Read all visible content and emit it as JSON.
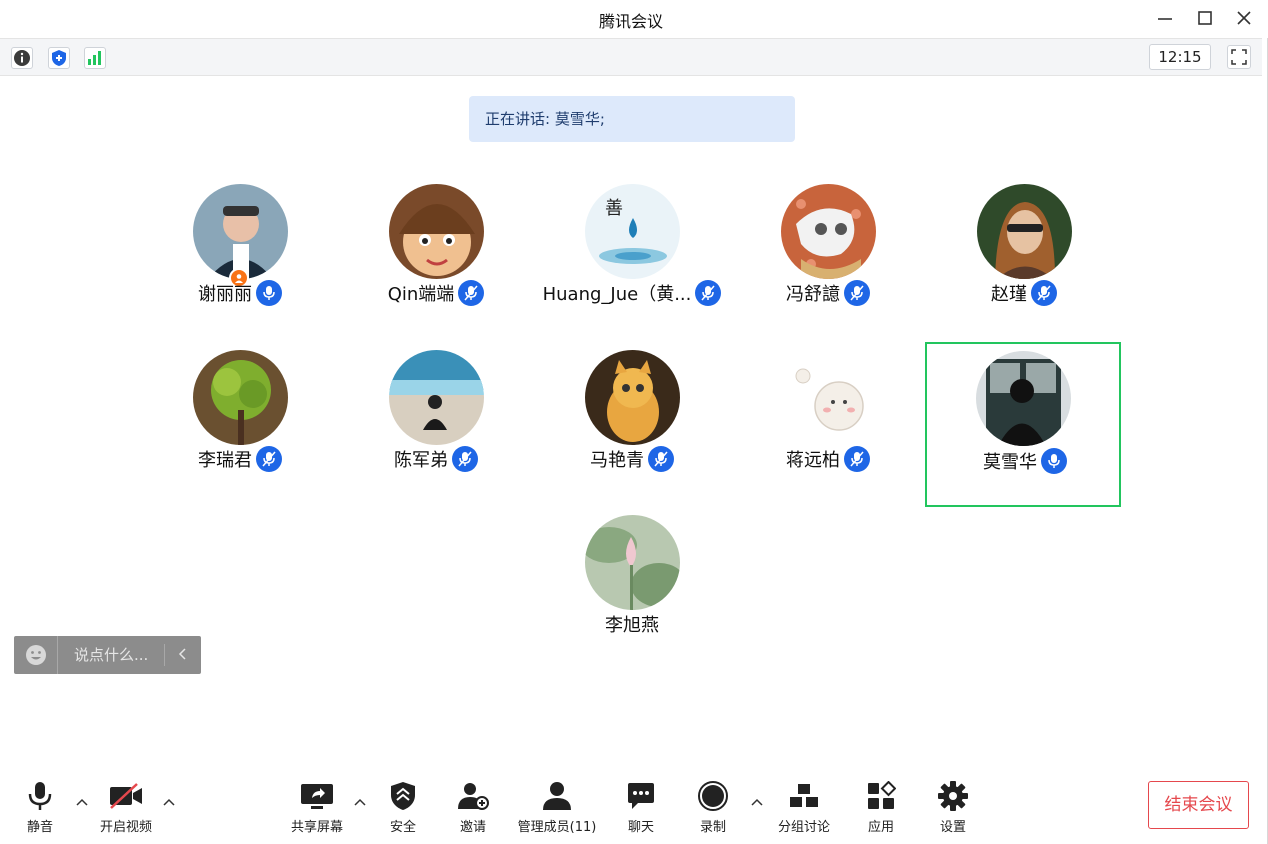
{
  "window": {
    "title": "腾讯会议",
    "minimize_icon": "minimize-icon",
    "maximize_icon": "maximize-icon",
    "close_icon": "close-icon"
  },
  "infobar": {
    "icons": [
      "info-icon",
      "shield-icon",
      "signal-icon"
    ],
    "clock": "12:15",
    "fullscreen_icon": "fullscreen-icon"
  },
  "speaking": {
    "text": "正在讲话: 莫雪华;"
  },
  "participants": [
    {
      "name": "谢丽丽",
      "host": true,
      "mic": "mic-icon"
    },
    {
      "name": "Qin端端",
      "host": false,
      "mic": "mic-icon"
    },
    {
      "name": "Huang_Jue（黄...",
      "host": false,
      "mic": "mic-icon"
    },
    {
      "name": "冯舒譩",
      "host": false,
      "mic": "mic-icon"
    },
    {
      "name": "赵瑾",
      "host": false,
      "mic": "mic-icon"
    },
    {
      "name": "李瑞君",
      "host": false,
      "mic": "mic-icon"
    },
    {
      "name": "陈军弟",
      "host": false,
      "mic": "mic-icon"
    },
    {
      "name": "马艳青",
      "host": false,
      "mic": "mic-icon"
    },
    {
      "name": "蒋远柏",
      "host": false,
      "mic": "mic-icon"
    },
    {
      "name": "莫雪华",
      "host": false,
      "mic": "mic-icon",
      "active": true
    },
    {
      "name": "李旭燕",
      "host": false
    }
  ],
  "chat": {
    "placeholder": "说点什么...",
    "emoji_icon": "emoji-icon",
    "collapse_icon": "chevron-left-icon"
  },
  "toolbar": {
    "mute": "静音",
    "video": "开启视频",
    "share": "共享屏幕",
    "security": "安全",
    "invite": "邀请",
    "members": "管理成员(11)",
    "chat": "聊天",
    "record": "录制",
    "breakout": "分组讨论",
    "apps": "应用",
    "settings": "设置",
    "end": "结束会议"
  },
  "colors": {
    "accent": "#1e66e6",
    "active_border": "#22c55e",
    "end_button": "#e5484d",
    "speaking_bg": "#dde9fb"
  }
}
